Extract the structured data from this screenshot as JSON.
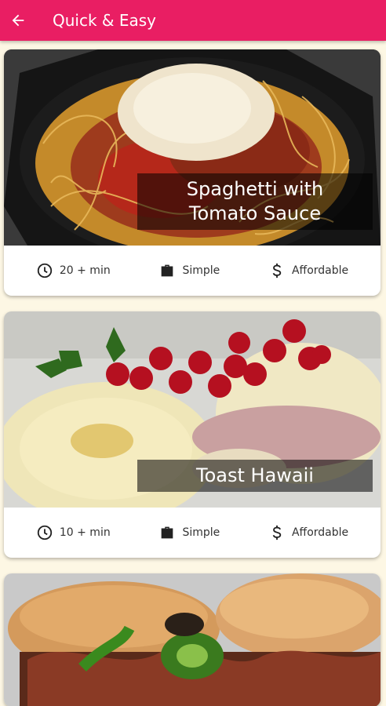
{
  "appbar": {
    "title": "Quick & Easy",
    "back_icon": "arrow-back-icon"
  },
  "colors": {
    "primary": "#e91e63",
    "background": "#fdf7e4",
    "card": "#ffffff"
  },
  "meals": [
    {
      "title": "Spaghetti with Tomato Sauce",
      "duration": "20 + min",
      "complexity": "Simple",
      "affordability": "Affordable"
    },
    {
      "title": "Toast Hawaii",
      "duration": "10 + min",
      "complexity": "Simple",
      "affordability": "Affordable"
    },
    {
      "title": "",
      "duration": "",
      "complexity": "",
      "affordability": ""
    }
  ],
  "icons": {
    "duration": "clock-icon",
    "complexity": "briefcase-icon",
    "affordability": "dollar-icon"
  }
}
